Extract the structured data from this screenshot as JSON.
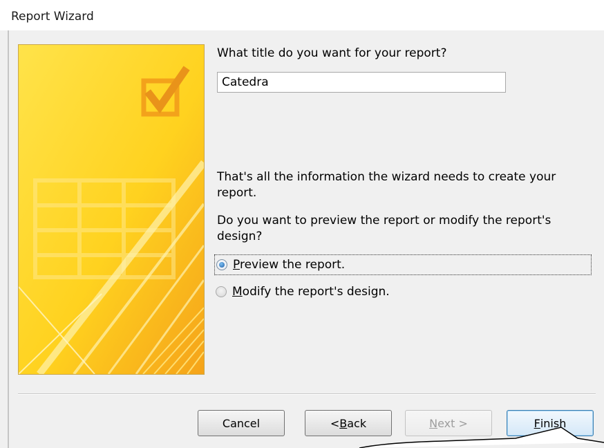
{
  "window": {
    "title": "Report Wizard"
  },
  "question": {
    "title_prompt": "What title do you want for your report?"
  },
  "title_field": {
    "value": "Catedra"
  },
  "info": {
    "line1": "That's all the information the wizard needs to create your",
    "line2": "report.",
    "line3": "Do you want to preview the report or modify the report's",
    "line4": "design?"
  },
  "options": {
    "preview": {
      "accel": "P",
      "rest": "review the report.",
      "checked": true
    },
    "modify": {
      "accel": "M",
      "rest": "odify the report's design.",
      "checked": false
    }
  },
  "buttons": {
    "cancel": "Cancel",
    "back_prefix": "< ",
    "back_accel": "B",
    "back_rest": "ack",
    "next_accel": "N",
    "next_rest": "ext >",
    "finish_accel": "F",
    "finish_rest": "inish"
  },
  "colors": {
    "panel_yellow": "#ffd21f",
    "panel_orange": "#f5a31a",
    "panel_border": "#c9a64a",
    "dialog_bg": "#f0f0f0",
    "default_button_border": "#3c7fb1"
  }
}
